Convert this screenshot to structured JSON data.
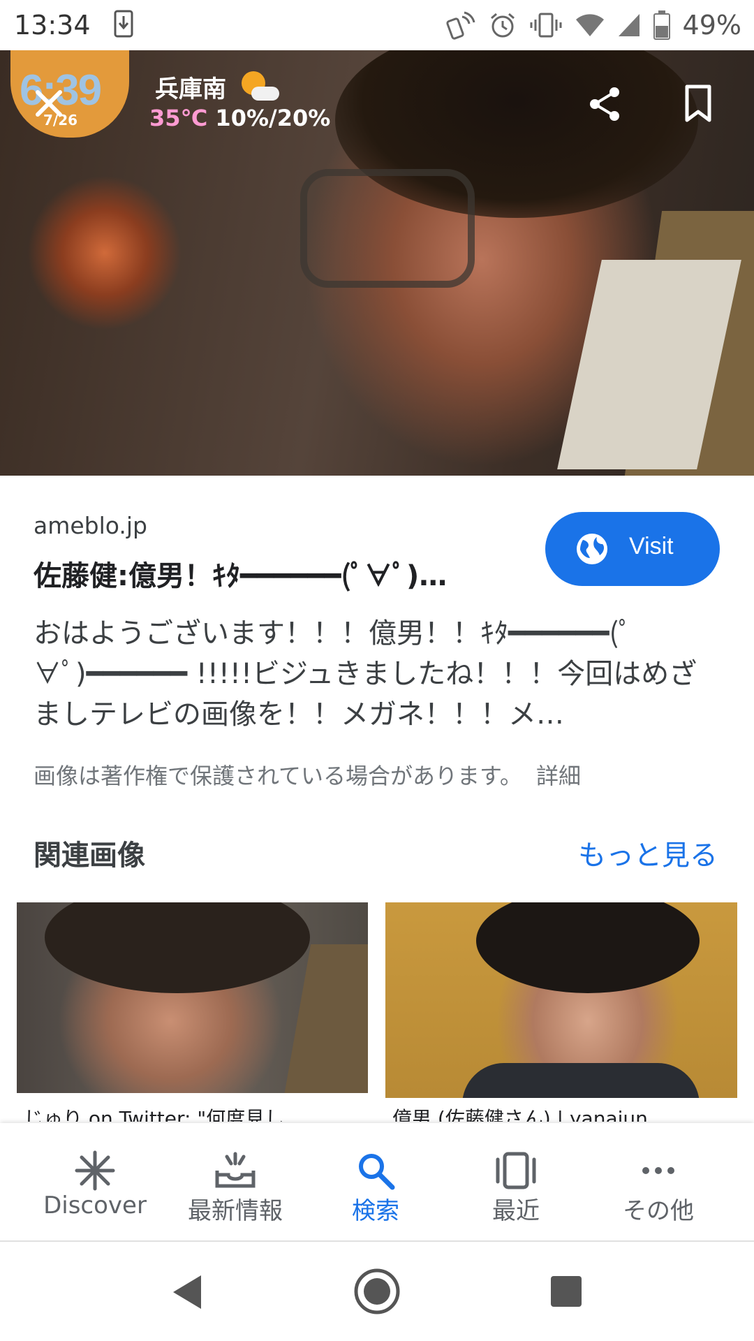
{
  "status_bar": {
    "time": "13:34",
    "battery": "49%"
  },
  "hero": {
    "overlay_clock": "6:39",
    "overlay_date": "7/26",
    "overlay_region": "兵庫南",
    "overlay_temp": "35℃",
    "overlay_precip": "10%/20%"
  },
  "result": {
    "domain": "ameblo.jp",
    "title": "佐藤健:億男！ｷﾀ━━━━━━(ﾟ∀ﾟ)…",
    "visit_label": "Visit",
    "description": "おはようございます！！！億男！！ｷﾀ━━━━━━(ﾟ∀ﾟ)━━━━━━ !!!!!ビジュきましたね！！！今回はめざましテレビの画像を！！メガネ！！！メ…",
    "copyright_notice": "画像は著作権で保護されている場合があります。",
    "copyright_details": "詳細"
  },
  "related": {
    "heading": "関連画像",
    "more_label": "もっと見る",
    "items": [
      {
        "caption": "じゅり on Twitter: \"何度見し"
      },
      {
        "caption": "億男 (佐藤健さん) | yanaiun"
      }
    ]
  },
  "bottom_nav": {
    "items": [
      {
        "label": "Discover",
        "icon": "asterisk-icon"
      },
      {
        "label": "最新情報",
        "icon": "updates-tray-icon"
      },
      {
        "label": "検索",
        "icon": "search-icon"
      },
      {
        "label": "最近",
        "icon": "recent-cards-icon"
      },
      {
        "label": "その他",
        "icon": "more-dots-icon"
      }
    ],
    "active_index": 2
  },
  "colors": {
    "accent": "#1a73e8",
    "text_primary": "#202124",
    "text_secondary": "#70757a"
  }
}
